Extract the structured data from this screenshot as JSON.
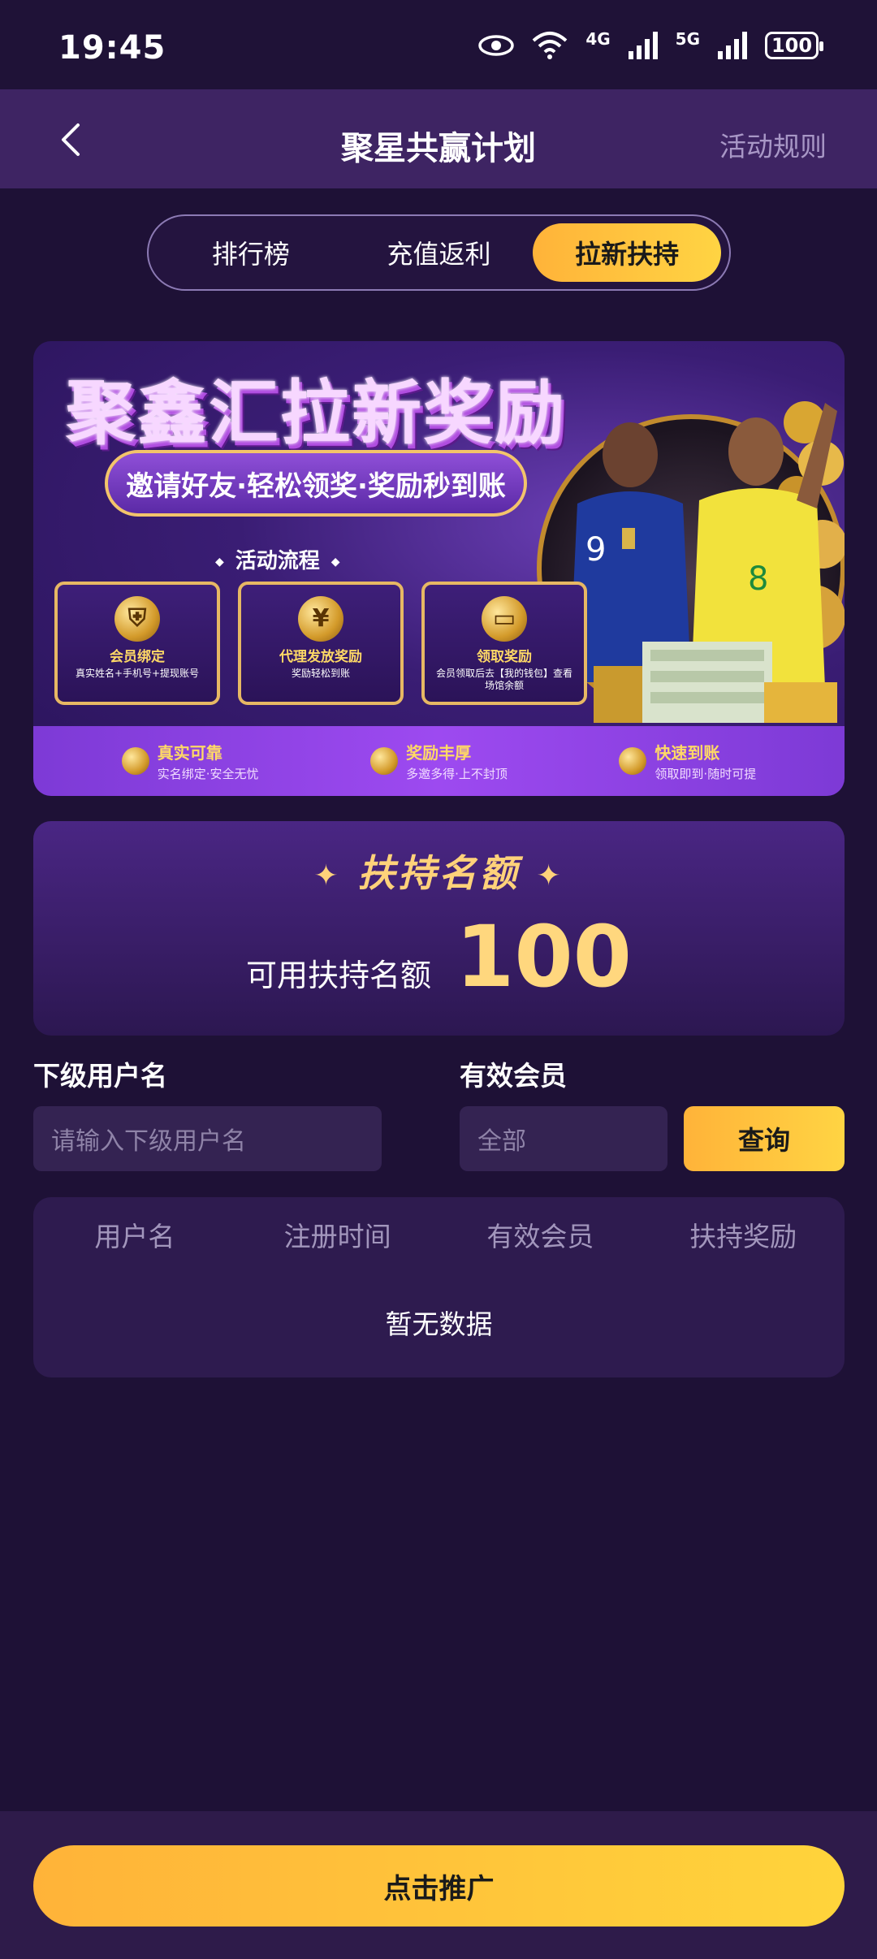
{
  "status": {
    "time": "19:45",
    "net1": "4G",
    "net2": "5G",
    "battery": "100"
  },
  "header": {
    "title": "聚星共赢计划",
    "rules": "活动规则"
  },
  "tabs": [
    {
      "label": "排行榜",
      "active": false
    },
    {
      "label": "充值返利",
      "active": false
    },
    {
      "label": "拉新扶持",
      "active": true
    }
  ],
  "banner": {
    "title": "聚鑫汇拉新奖励",
    "subtitle": "邀请好友·轻松领奖·奖励秒到账",
    "process_label": "活动流程",
    "steps": [
      {
        "icon": "shield-icon",
        "title": "会员绑定",
        "desc": "真实姓名+手机号+提现账号"
      },
      {
        "icon": "yen-coin-icon",
        "title": "代理发放奖励",
        "desc": "奖励轻松到账"
      },
      {
        "icon": "wallet-icon",
        "title": "领取奖励",
        "desc": "会员领取后去【我的钱包】查看场馆余额"
      }
    ],
    "features": [
      {
        "title": "真实可靠",
        "desc": "实名绑定·安全无忧"
      },
      {
        "title": "奖励丰厚",
        "desc": "多邀多得·上不封顶"
      },
      {
        "title": "快速到账",
        "desc": "领取即到·随时可提"
      }
    ]
  },
  "quota": {
    "heading": "扶持名额",
    "label": "可用扶持名额",
    "value": "100"
  },
  "filters": {
    "username_label": "下级用户名",
    "username_placeholder": "请输入下级用户名",
    "member_label": "有效会员",
    "member_value": "全部",
    "query_button": "查询"
  },
  "table": {
    "headers": [
      "用户名",
      "注册时间",
      "有效会员",
      "扶持奖励"
    ],
    "empty_text": "暂无数据"
  },
  "footer": {
    "promote_button": "点击推广"
  },
  "colors": {
    "background": "#1e1136",
    "accent": "#ffc23d",
    "card": "#2e1b4f"
  }
}
